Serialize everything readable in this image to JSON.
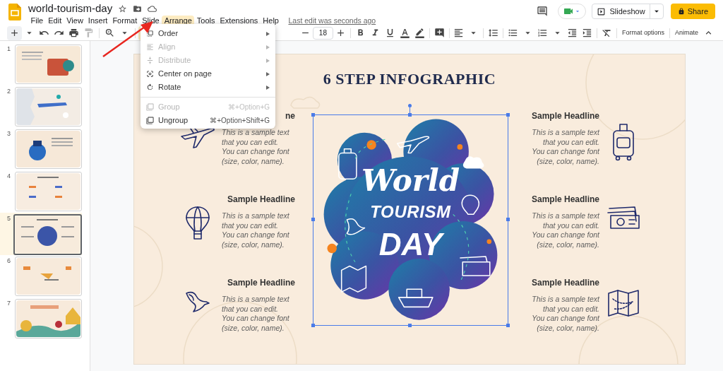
{
  "doc": {
    "title": "world-tourism-day",
    "last_edit": "Last edit was seconds ago"
  },
  "menu_bar": [
    {
      "label": "File",
      "selected": false
    },
    {
      "label": "Edit",
      "selected": false
    },
    {
      "label": "View",
      "selected": false
    },
    {
      "label": "Insert",
      "selected": false
    },
    {
      "label": "Format",
      "selected": false
    },
    {
      "label": "Slide",
      "selected": false
    },
    {
      "label": "Arrange",
      "selected": true
    },
    {
      "label": "Tools",
      "selected": false
    },
    {
      "label": "Extensions",
      "selected": false
    },
    {
      "label": "Help",
      "selected": false
    }
  ],
  "header_buttons": {
    "slideshow": "Slideshow",
    "share": "Share"
  },
  "toolbar": {
    "select_tool": {
      "selected": true
    },
    "font_size": "18",
    "format_options": "Format options",
    "animate": "Animate"
  },
  "arrange_menu": [
    {
      "kind": "item",
      "label": "Order",
      "disabled": false,
      "submenu": true
    },
    {
      "kind": "item",
      "label": "Align",
      "disabled": true,
      "submenu": true
    },
    {
      "kind": "item",
      "label": "Distribute",
      "disabled": true,
      "submenu": true
    },
    {
      "kind": "item",
      "label": "Center on page",
      "disabled": false,
      "submenu": true
    },
    {
      "kind": "item",
      "label": "Rotate",
      "disabled": false,
      "submenu": true
    },
    {
      "kind": "divider"
    },
    {
      "kind": "item",
      "label": "Group",
      "disabled": true,
      "shortcut": "⌘+Option+G"
    },
    {
      "kind": "item",
      "label": "Ungroup",
      "disabled": false,
      "shortcut": "⌘+Option+Shift+G"
    }
  ],
  "slides": [
    {
      "number": "1",
      "selected": false
    },
    {
      "number": "2",
      "selected": false
    },
    {
      "number": "3",
      "selected": false
    },
    {
      "number": "4",
      "selected": false
    },
    {
      "number": "5",
      "selected": true
    },
    {
      "number": "6",
      "selected": false
    },
    {
      "number": "7",
      "selected": false
    }
  ],
  "slide": {
    "title": "6 STEP INFOGRAPHIC",
    "artwork_lettering": [
      "World",
      "TOURISM",
      "DAY"
    ],
    "left_steps": [
      {
        "headline": "ne",
        "body": "This is a sample text\nthat you can edit.\nYou can change font\n(size, color, name)."
      },
      {
        "headline": "Sample Headline",
        "body": "This is a sample text\nthat you can edit.\nYou can change font\n(size, color, name)."
      },
      {
        "headline": "Sample Headline",
        "body": "This is a sample text\nthat you can edit.\nYou can change font\n(size, color, name)."
      }
    ],
    "right_steps": [
      {
        "headline": "Sample Headline",
        "body": "This is a sample text\nthat you can edit.\nYou can change font\n(size, color, name)."
      },
      {
        "headline": "Sample Headline",
        "body": "This is a sample text\nthat you can edit.\nYou can change font\n(size, color, name)."
      },
      {
        "headline": "Sample Headline",
        "body": "This is a sample text\nthat you can edit.\nYou can change font\n(size, color, name)."
      }
    ]
  }
}
